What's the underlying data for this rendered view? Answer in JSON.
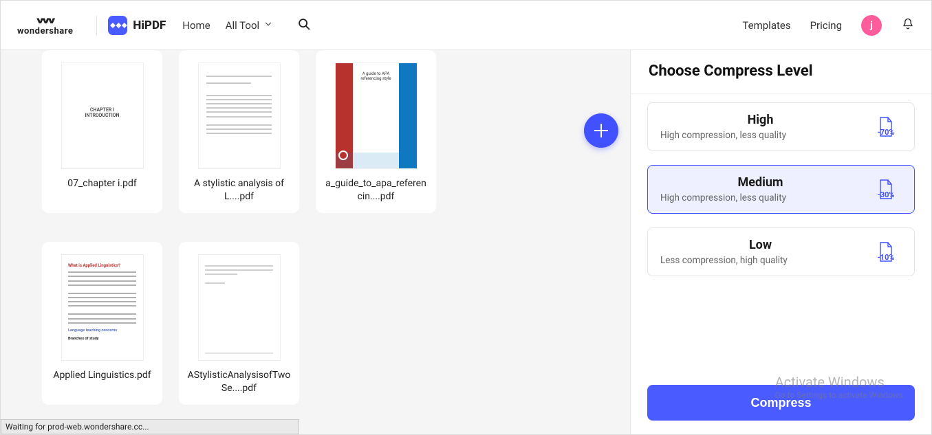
{
  "header": {
    "brand_word": "wondershare",
    "app_name": "HiPDF",
    "nav": {
      "home": "Home",
      "all_tools": "All Tool"
    },
    "right": {
      "templates": "Templates",
      "pricing": "Pricing",
      "avatar_initial": "j"
    }
  },
  "files": [
    {
      "name": "07_chapter i.pdf"
    },
    {
      "name": "A stylistic analysis of L....pdf"
    },
    {
      "name": "a_guide_to_apa_referencin....pdf"
    },
    {
      "name": "Applied Linguistics.pdf"
    },
    {
      "name": "AStylisticAnalysisofTwoSe....pdf"
    }
  ],
  "panel": {
    "title": "Choose Compress Level",
    "levels": [
      {
        "name": "High",
        "desc": "High compression, less quality",
        "pct": "-70%",
        "selected": false
      },
      {
        "name": "Medium",
        "desc": "High compression, less quality",
        "pct": "-30%",
        "selected": true
      },
      {
        "name": "Low",
        "desc": "Less compression, high quality",
        "pct": "-10%",
        "selected": false
      }
    ],
    "action": "Compress"
  },
  "watermark": {
    "l1": "Activate Windows",
    "l2_a": "Go to Settings to activate Windows.",
    "l2_b": ""
  },
  "status": "Waiting for prod-web.wondershare.cc..."
}
